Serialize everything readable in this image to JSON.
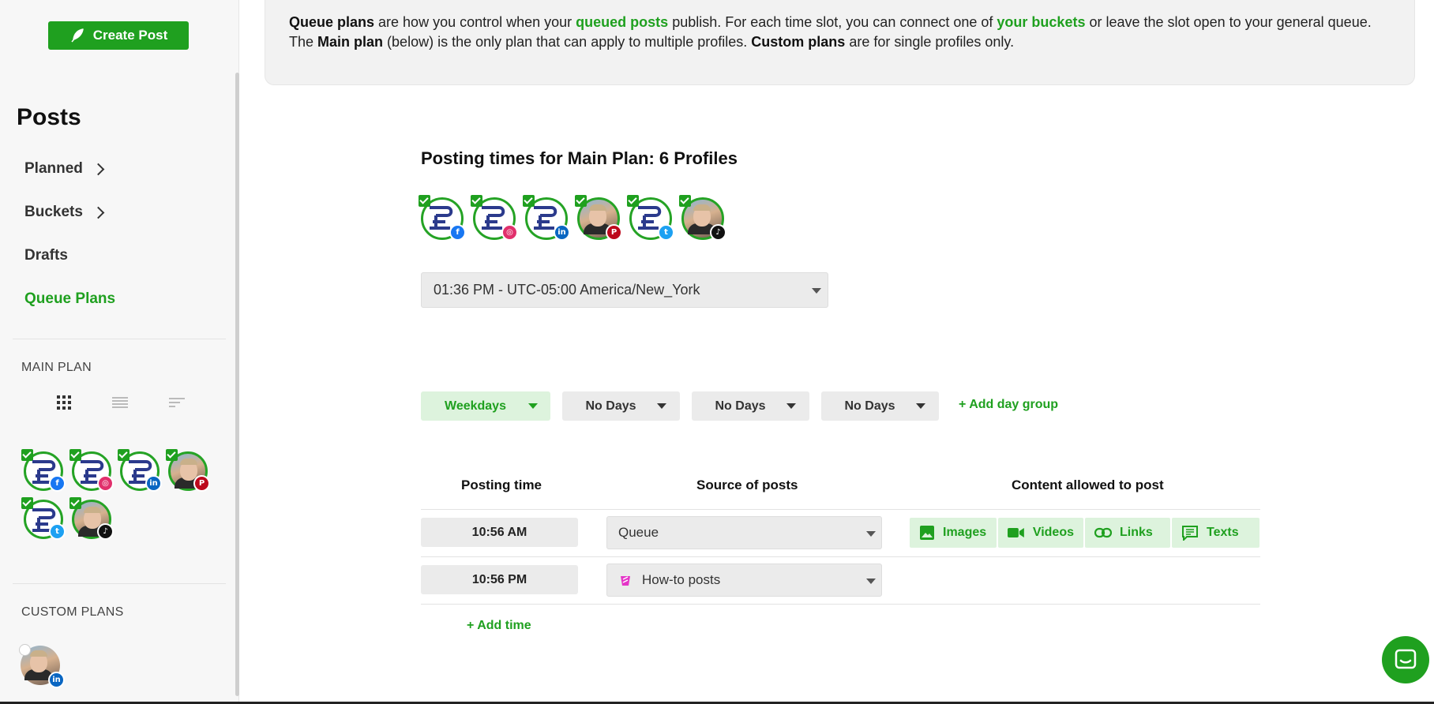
{
  "sidebar": {
    "create_label": "Create Post",
    "title": "Posts",
    "nav": [
      {
        "label": "Planned"
      },
      {
        "label": "Buckets"
      },
      {
        "label": "Drafts"
      },
      {
        "label": "Queue Plans"
      }
    ],
    "main_plan_label": "MAIN PLAN",
    "custom_plans_label": "CUSTOM PLANS"
  },
  "info": {
    "t1": "Queue plans",
    "t2": " are how you control when your ",
    "t3": "queued posts",
    "t4": " publish. For each time slot, you can connect one of ",
    "t5": "your buckets",
    "t6": " or leave the slot open to your general queue. The ",
    "t7": "Main plan",
    "t8": " (below) is the only plan that can apply to multiple profiles. ",
    "t9": "Custom plans",
    "t10": " are for single profiles only."
  },
  "main": {
    "posting_title": "Posting times for  Main Plan: 6 Profiles",
    "profiles": [
      {
        "network": "facebook",
        "type": "logo",
        "color": "#1877f2"
      },
      {
        "network": "instagram",
        "type": "logo",
        "color": "#e1306c"
      },
      {
        "network": "linkedin",
        "type": "logo",
        "color": "#0a66c2"
      },
      {
        "network": "pinterest",
        "type": "photo",
        "color": "#bd081c"
      },
      {
        "network": "twitter",
        "type": "logo",
        "color": "#1da1f2"
      },
      {
        "network": "tiktok",
        "type": "photo",
        "color": "#111111"
      }
    ],
    "timezone": "01:36 PM - UTC-05:00 America/New_York",
    "day_groups": [
      "Weekdays",
      "No Days",
      "No Days",
      "No Days"
    ],
    "add_day_group": "+ Add day group",
    "headers": {
      "time": "Posting time",
      "source": "Source of posts",
      "content": "Content allowed to post"
    },
    "rows": [
      {
        "time": "10:56 AM",
        "source": "Queue"
      },
      {
        "time": "10:56 PM",
        "source": "How-to posts"
      }
    ],
    "content_types": [
      "Images",
      "Videos",
      "Links",
      "Texts"
    ],
    "add_time": "+ Add time"
  },
  "colors": {
    "accent": "#1fa01f",
    "accent_light": "#ddf3dd"
  }
}
